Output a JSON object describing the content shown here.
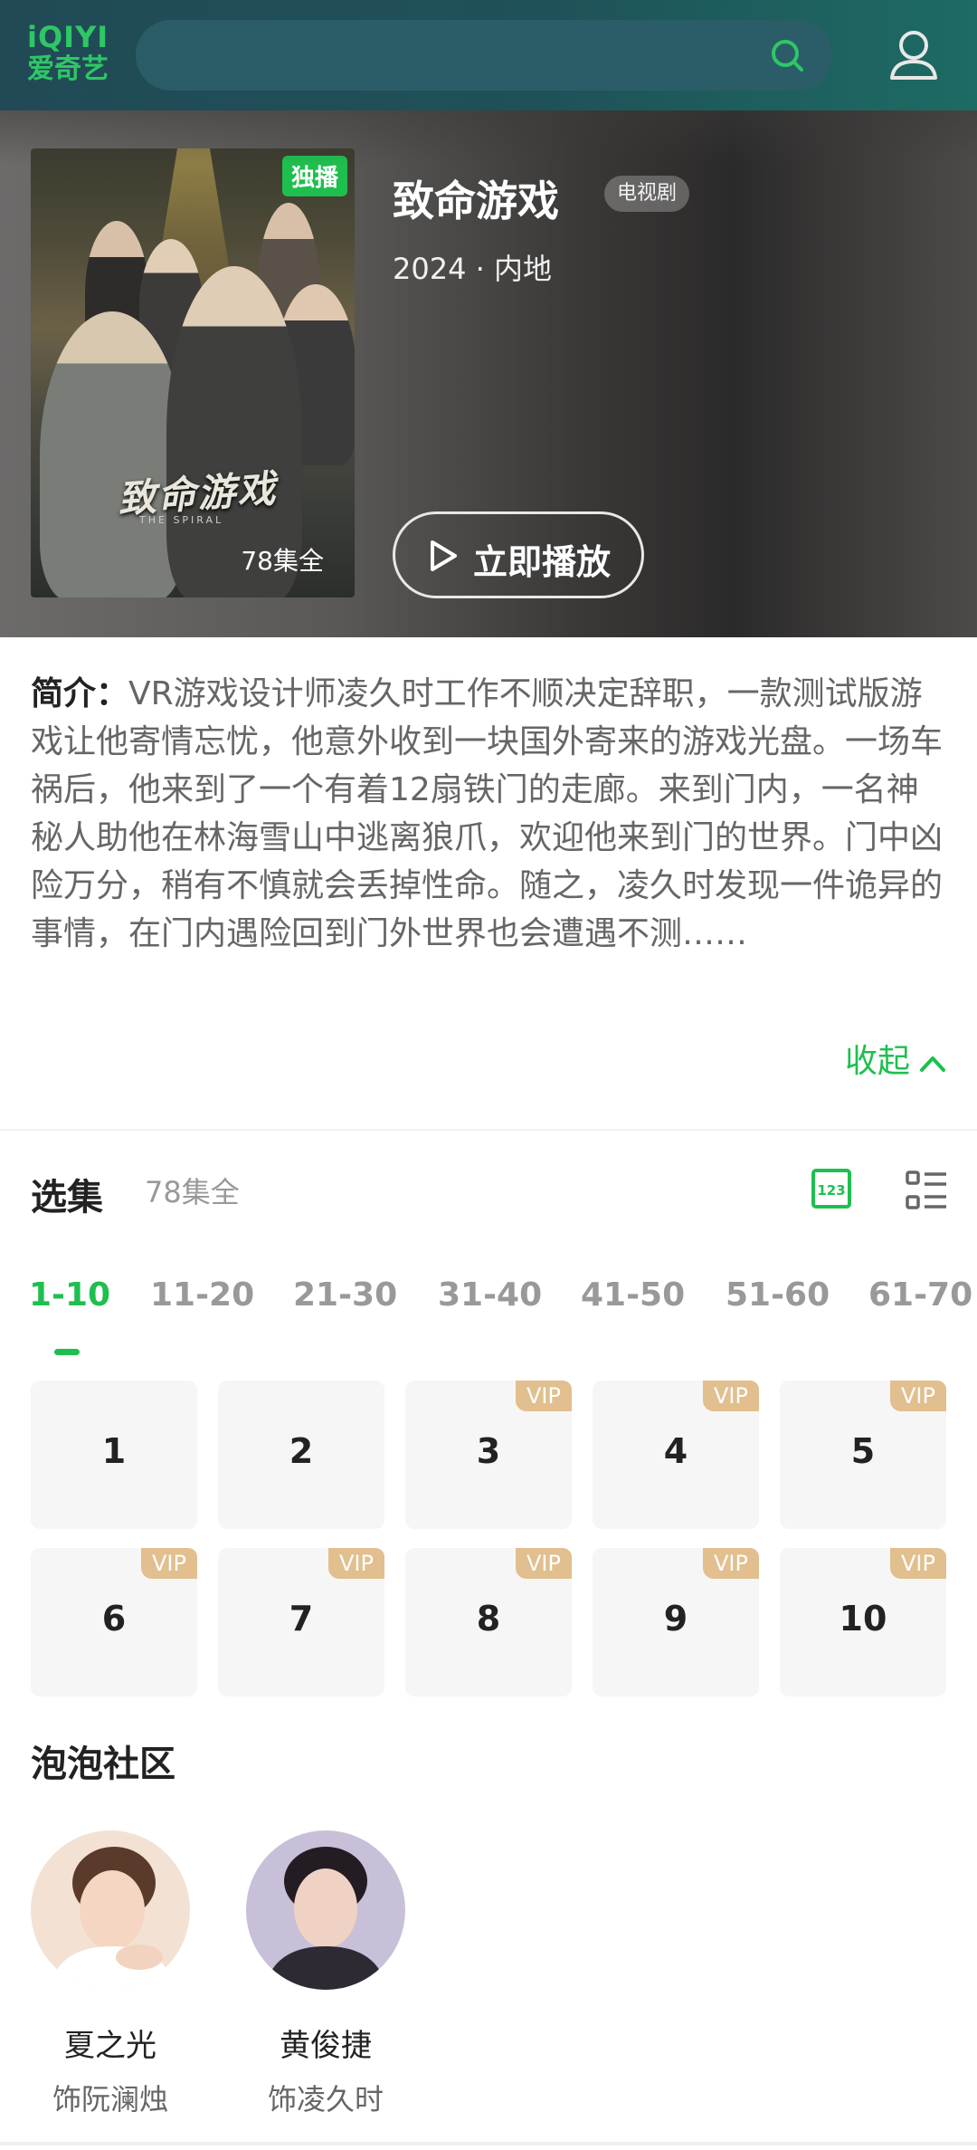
{
  "header": {
    "logo_top": "iQIYI",
    "logo_bottom": "爱奇艺",
    "search_placeholder": "",
    "icons": [
      "search-icon",
      "user-icon"
    ],
    "accent": "#2ec766"
  },
  "hero": {
    "exclusive_badge": "独播",
    "poster_title": "致命游戏",
    "poster_subtitle": "THE SPIRAL",
    "poster_episode_total": "78集全",
    "title": "致命游戏",
    "type": "电视剧",
    "meta": "2024 · 内地",
    "play_label": "立即播放"
  },
  "synopsis": {
    "label": "简介：",
    "text": "VR游戏设计师凌久时工作不顺决定辞职，一款测试版游戏让他寄情忘忧，他意外收到一块国外寄来的游戏光盘。一场车祸后，他来到了一个有着12扇铁门的走廊。来到门内，一名神秘人助他在林海雪山中逃离狼爪，欢迎他来到门的世界。门中凶险万分，稍有不慎就会丢掉性命。随之，凌久时发现一件诡异的事情，在门内遇险回到门外世界也会遭遇不测……",
    "collapse_label": "收起"
  },
  "episodes": {
    "section_title": "选集",
    "count": "78集全",
    "ranges": [
      "1-10",
      "11-20",
      "21-30",
      "31-40",
      "41-50",
      "51-60",
      "61-70"
    ],
    "active_range": "1-10",
    "vip_label": "VIP",
    "items": [
      {
        "num": "1",
        "vip": false
      },
      {
        "num": "2",
        "vip": false
      },
      {
        "num": "3",
        "vip": true
      },
      {
        "num": "4",
        "vip": true
      },
      {
        "num": "5",
        "vip": true
      },
      {
        "num": "6",
        "vip": true
      },
      {
        "num": "7",
        "vip": true
      },
      {
        "num": "8",
        "vip": true
      },
      {
        "num": "9",
        "vip": true
      },
      {
        "num": "10",
        "vip": true
      }
    ],
    "colors": {
      "active": "#1fbf4f",
      "vip": "#e1bf8e"
    }
  },
  "community": {
    "section_title": "泡泡社区",
    "cast": [
      {
        "name": "夏之光",
        "role": "饰阮澜烛"
      },
      {
        "name": "黄俊捷",
        "role": "饰凌久时"
      }
    ]
  }
}
